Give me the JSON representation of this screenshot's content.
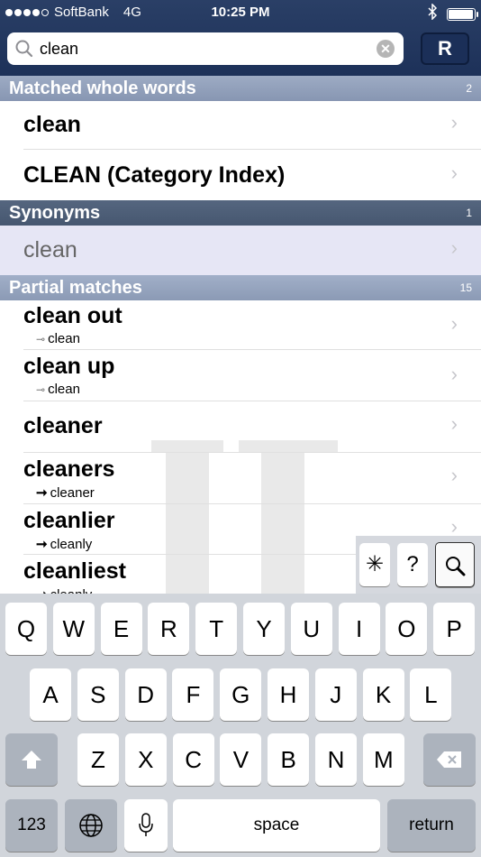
{
  "status": {
    "carrier": "SoftBank",
    "network": "4G",
    "time": "10:25 PM",
    "battery_level": 0.95,
    "bluetooth_icon": "bluetooth-icon"
  },
  "search": {
    "value": "clean",
    "r_button_label": "R"
  },
  "sections": {
    "matched": {
      "title": "Matched whole words",
      "count": "2"
    },
    "synonyms": {
      "title": "Synonyms",
      "count": "1"
    },
    "partial": {
      "title": "Partial matches",
      "count": "15"
    }
  },
  "matched_rows": [
    {
      "title": "clean"
    },
    {
      "title": "CLEAN (Category Index)"
    }
  ],
  "synonym_rows": [
    {
      "title": "clean"
    }
  ],
  "partial_rows": [
    {
      "title": "clean out",
      "sub_marker": "⊸",
      "sub": "clean"
    },
    {
      "title": "clean up",
      "sub_marker": "⊸",
      "sub": "clean"
    },
    {
      "title": "cleaner"
    },
    {
      "title": "cleaners",
      "sub_marker": "➞",
      "sub": "cleaner"
    },
    {
      "title": "cleanlier",
      "sub_marker": "➞",
      "sub": "cleanly"
    },
    {
      "title": "cleanliest",
      "sub_marker": "➞",
      "sub": "cleanly"
    }
  ],
  "mini_toolbar": {
    "asterisk": "✳",
    "question": "?"
  },
  "keyboard": {
    "row1": [
      "Q",
      "W",
      "E",
      "R",
      "T",
      "Y",
      "U",
      "I",
      "O",
      "P"
    ],
    "row2": [
      "A",
      "S",
      "D",
      "F",
      "G",
      "H",
      "J",
      "K",
      "L"
    ],
    "row3": [
      "Z",
      "X",
      "C",
      "V",
      "B",
      "N",
      "M"
    ],
    "numbers_label": "123",
    "space_label": "space",
    "return_label": "return"
  }
}
